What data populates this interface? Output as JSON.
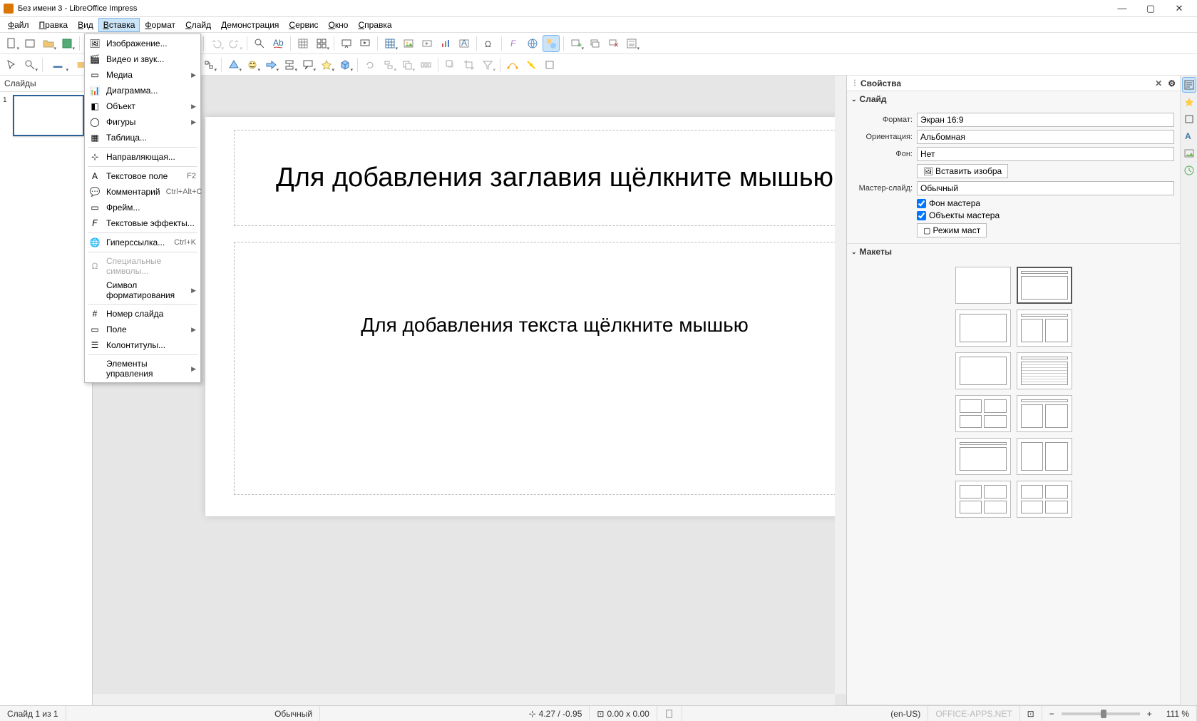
{
  "window": {
    "title": "Без имени 3 - LibreOffice Impress"
  },
  "menubar": {
    "items": [
      "Файл",
      "Правка",
      "Вид",
      "Вставка",
      "Формат",
      "Слайд",
      "Демонстрация",
      "Сервис",
      "Окно",
      "Справка"
    ],
    "active_index": 3
  },
  "dropdown": {
    "groups": [
      [
        {
          "label": "Изображение...",
          "icon": "image"
        },
        {
          "label": "Видео и звук...",
          "icon": "media"
        },
        {
          "label": "Медиа",
          "submenu": true,
          "icon": "media2"
        },
        {
          "label": "Диаграмма...",
          "icon": "chart"
        },
        {
          "label": "Объект",
          "submenu": true,
          "icon": "object"
        },
        {
          "label": "Фигуры",
          "submenu": true,
          "icon": "shapes"
        },
        {
          "label": "Таблица...",
          "icon": "table"
        }
      ],
      [
        {
          "label": "Направляющая...",
          "icon": "guide"
        }
      ],
      [
        {
          "label": "Текстовое поле",
          "shortcut": "F2",
          "icon": "text"
        },
        {
          "label": "Комментарий",
          "shortcut": "Ctrl+Alt+C",
          "icon": "comment"
        },
        {
          "label": "Фрейм...",
          "icon": "frame"
        },
        {
          "label": "Текстовые эффекты...",
          "icon": "fontwork"
        }
      ],
      [
        {
          "label": "Гиперссылка...",
          "shortcut": "Ctrl+K",
          "icon": "link"
        }
      ],
      [
        {
          "label": "Специальные символы...",
          "icon": "specialchar",
          "disabled": true
        },
        {
          "label": "Символ форматирования",
          "submenu": true
        }
      ],
      [
        {
          "label": "Номер слайда",
          "icon": "slidenum"
        },
        {
          "label": "Поле",
          "submenu": true,
          "icon": "field"
        },
        {
          "label": "Колонтитулы...",
          "icon": "headerfooter"
        }
      ],
      [
        {
          "label": "Элементы управления",
          "submenu": true
        }
      ]
    ]
  },
  "slidepanel": {
    "header": "Слайды",
    "slides": [
      {
        "num": "1"
      }
    ]
  },
  "canvas": {
    "title_placeholder": "Для добавления заглавия щёлкните мышью",
    "content_placeholder": "Для добавления текста щёлкните мышью"
  },
  "properties": {
    "header": "Свойства",
    "sections": {
      "slide": {
        "title": "Слайд",
        "format_label": "Формат:",
        "format_value": "Экран 16:9",
        "orientation_label": "Ориентация:",
        "orientation_value": "Альбомная",
        "background_label": "Фон:",
        "background_value": "Нет",
        "insert_image": "Вставить изобра",
        "master_label": "Мастер-слайд:",
        "master_value": "Обычный",
        "master_bg": "Фон мастера",
        "master_objects": "Объекты мастера",
        "master_mode": "Режим маст"
      },
      "layouts": {
        "title": "Макеты",
        "selected_index": 1
      }
    }
  },
  "statusbar": {
    "slide_info": "Слайд 1 из 1",
    "template": "Обычный",
    "coords": "4.27 / -0.95",
    "size": "0.00 x 0.00",
    "lang": "(en-US)",
    "zoom": "111 %",
    "watermark": "OFFICE-APPS.NET"
  }
}
